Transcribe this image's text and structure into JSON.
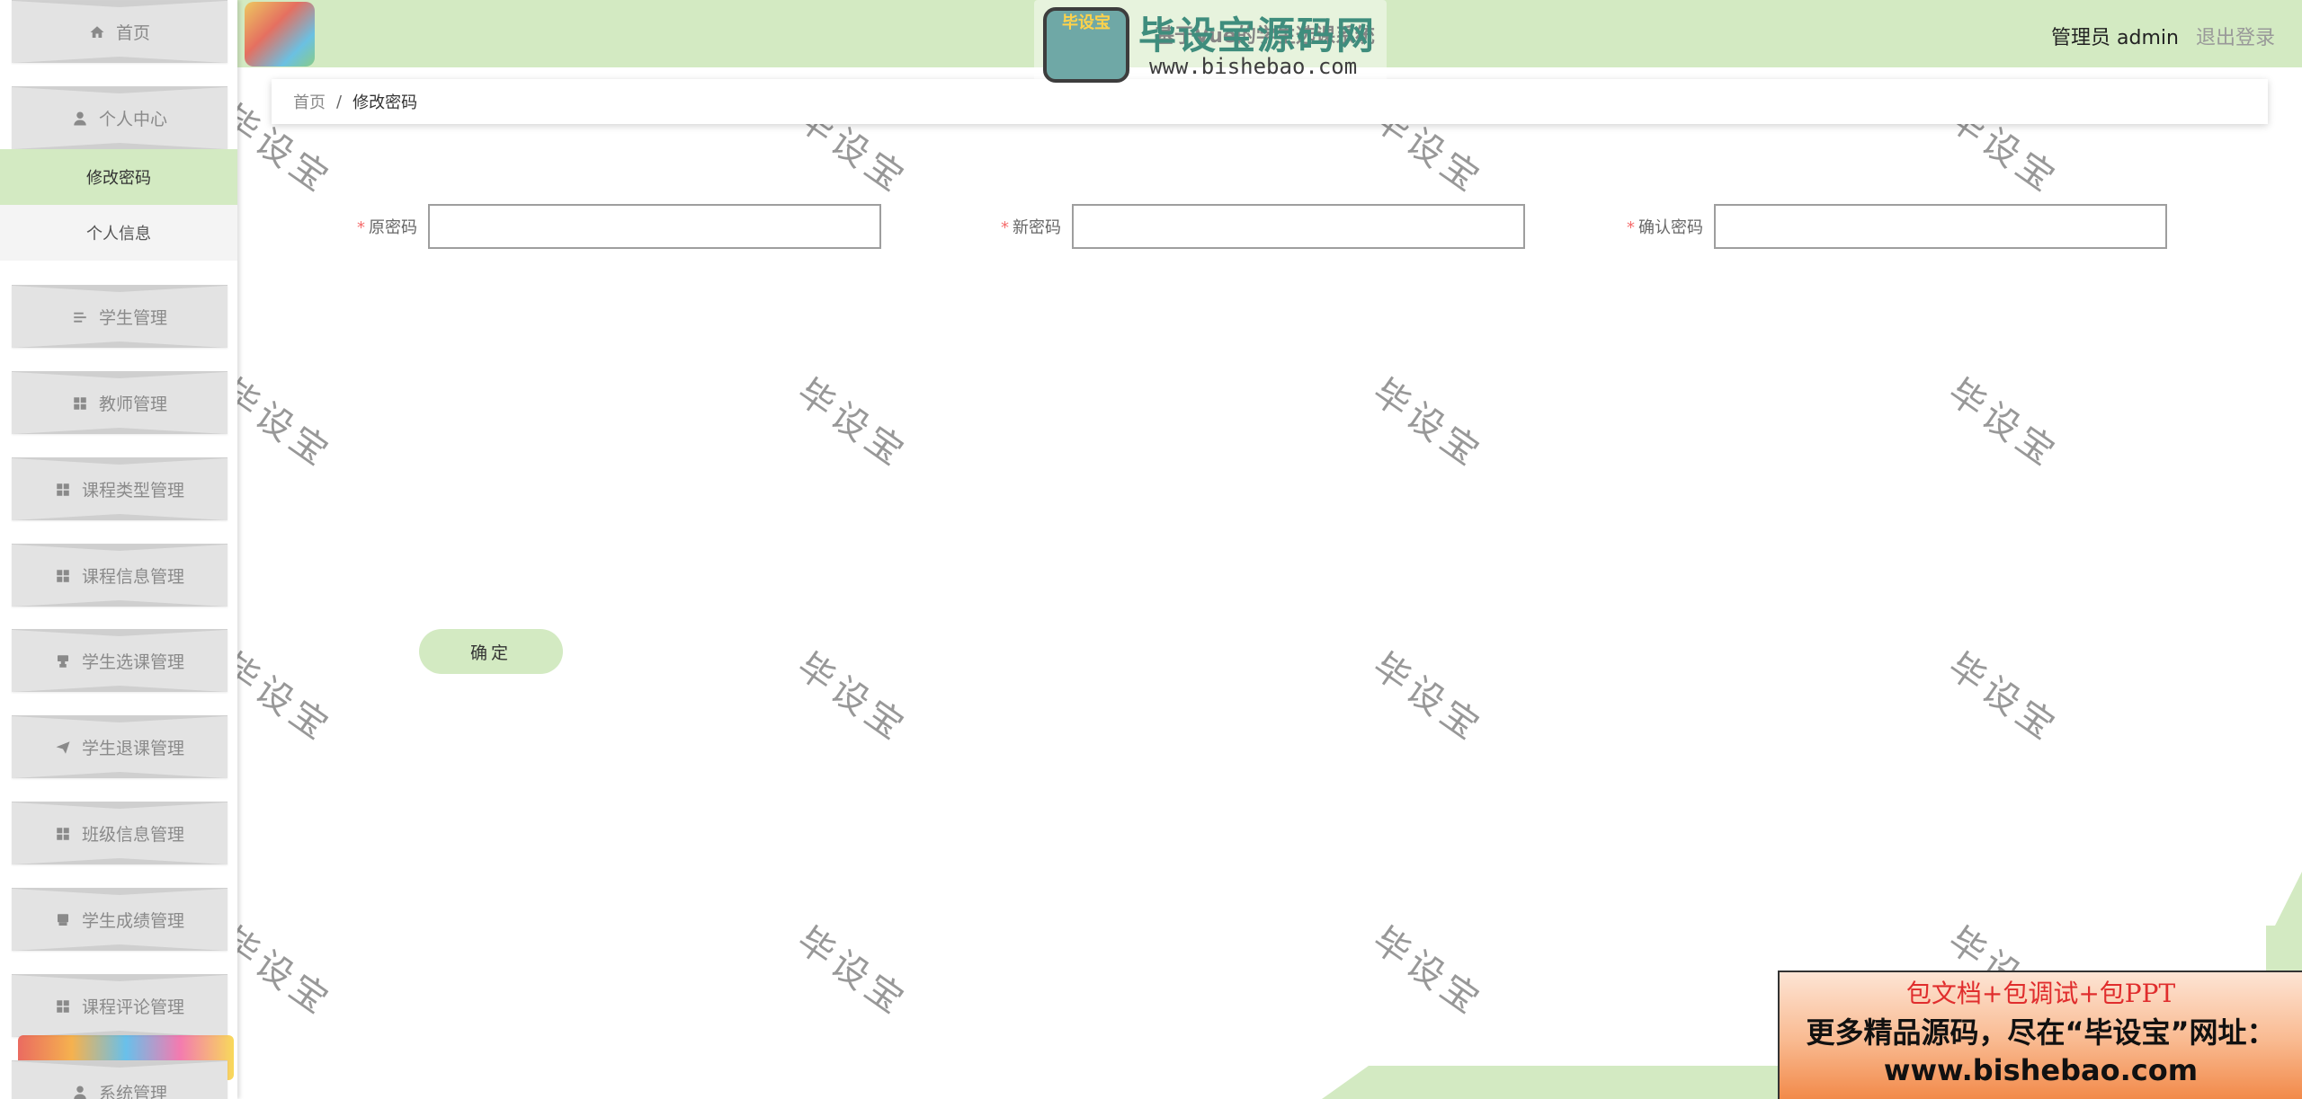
{
  "header": {
    "system_title": "基于Vue的学生选课系统",
    "user_label": "管理员 admin",
    "logout_label": "退出登录"
  },
  "brand_watermark": {
    "badge": "毕设宝",
    "name": "毕设宝源码网",
    "url": "www.bishebao.com"
  },
  "sidebar": {
    "items": [
      {
        "label": "首页",
        "icon": "home-icon"
      },
      {
        "label": "个人中心",
        "icon": "user-icon"
      },
      {
        "label": "学生管理",
        "icon": "list-icon"
      },
      {
        "label": "教师管理",
        "icon": "grid-icon"
      },
      {
        "label": "课程类型管理",
        "icon": "grid-icon"
      },
      {
        "label": "课程信息管理",
        "icon": "grid-icon"
      },
      {
        "label": "学生选课管理",
        "icon": "chair-icon"
      },
      {
        "label": "学生退课管理",
        "icon": "send-icon"
      },
      {
        "label": "班级信息管理",
        "icon": "grid-icon"
      },
      {
        "label": "学生成绩管理",
        "icon": "chair-icon"
      },
      {
        "label": "课程评论管理",
        "icon": "grid-icon"
      },
      {
        "label": "系统管理",
        "icon": "user-icon"
      }
    ],
    "submenu": [
      {
        "label": "修改密码",
        "active": true
      },
      {
        "label": "个人信息",
        "active": false
      }
    ]
  },
  "breadcrumb": {
    "home": "首页",
    "separator": "/",
    "current": "修改密码"
  },
  "form": {
    "fields": [
      {
        "label": "原密码",
        "value": ""
      },
      {
        "label": "新密码",
        "value": ""
      },
      {
        "label": "确认密码",
        "value": ""
      }
    ],
    "required_mark": "*",
    "submit_label": "确定"
  },
  "watermark_text": "毕设宝",
  "ad_banner": {
    "line1": "包文档+包调试+包PPT",
    "line2": "更多精品源码，尽在“毕设宝”网址：",
    "line3": "www.bishebao.com"
  },
  "colors": {
    "accent": "#d3eac2",
    "required": "#f56c6c",
    "menu_bg": "#e3e3e3"
  }
}
